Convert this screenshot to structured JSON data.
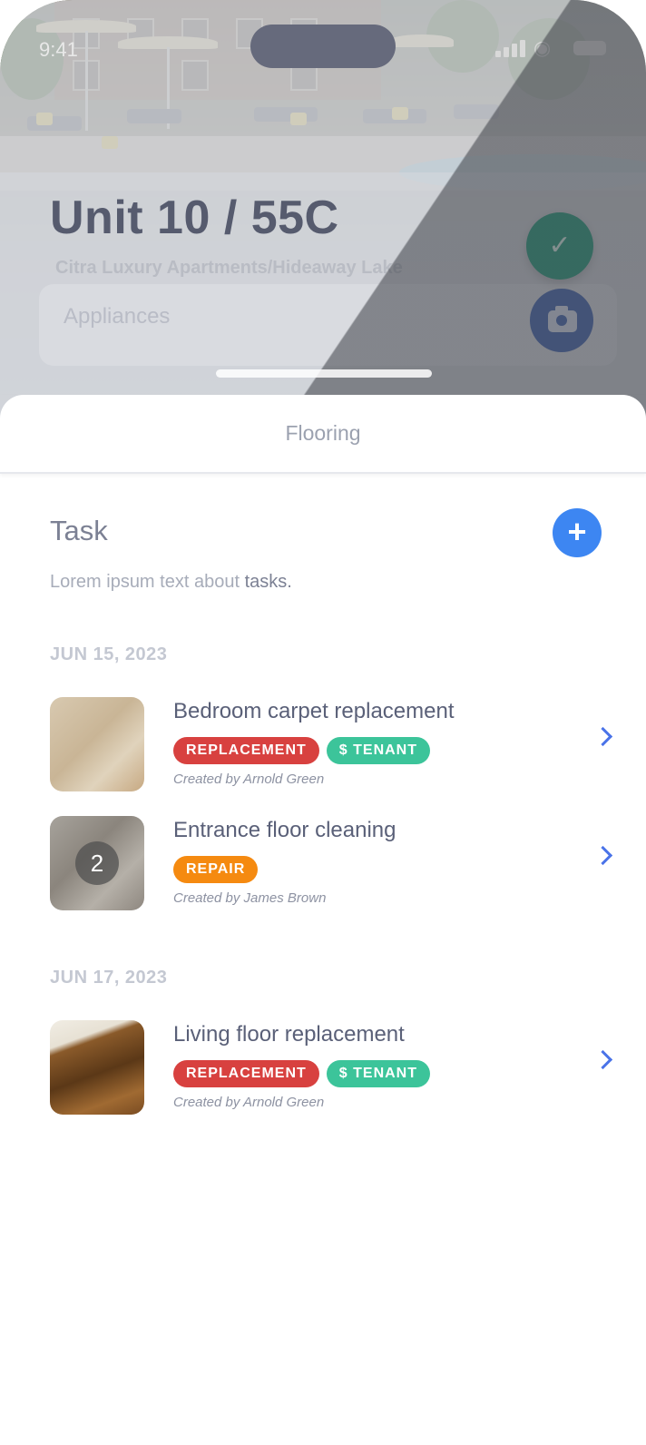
{
  "status_bar": {
    "time": "9:41"
  },
  "header": {
    "unit_title": "Unit 10 / 55C",
    "property": "Citra Luxury Apartments/Hideaway Lake",
    "category_field": "Appliances"
  },
  "sheet": {
    "title": "Flooring"
  },
  "task_section": {
    "heading": "Task",
    "description_prefix": "Lorem ipsum text about ",
    "description_highlight": "tasks.",
    "add_button": "+"
  },
  "groups": [
    {
      "date": "JUN 15, 2023",
      "items": [
        {
          "title": "Bedroom carpet replacement",
          "tags": [
            "REPLACEMENT",
            "$ TENANT"
          ],
          "creator": "Created by Arnold Green"
        },
        {
          "title": "Entrance floor cleaning",
          "tags": [
            "REPAIR"
          ],
          "creator": "Created by James Brown",
          "photo_count": "2"
        }
      ]
    },
    {
      "date": "JUN 17, 2023",
      "items": [
        {
          "title": "Living floor replacement",
          "tags": [
            "REPLACEMENT",
            "$ TENANT"
          ],
          "creator": "Created by Arnold Green"
        }
      ]
    }
  ],
  "icons": {
    "check": "check-icon",
    "camera": "camera-icon",
    "add": "plus-icon",
    "chevron": "chevron-right-icon"
  },
  "colors": {
    "accent_blue": "#3d86f2",
    "tag_replacement": "#d8413f",
    "tag_tenant": "#3cc49a",
    "tag_repair": "#f58a10",
    "confirm_green": "#2f9d7f"
  }
}
